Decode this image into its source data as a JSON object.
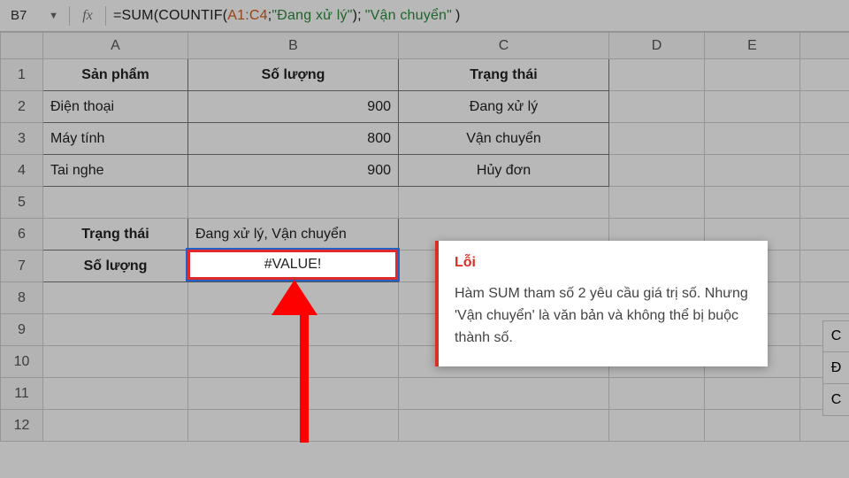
{
  "formula_bar": {
    "cell_ref": "B7",
    "fx_label": "fx",
    "formula_prefix": "=",
    "fn_sum": "SUM",
    "fn_countif": "COUNTIF",
    "range": "A1:C4",
    "sep": ";",
    "str1": "\"Đang xử lý\"",
    "str2": "\"Vận chuyển\""
  },
  "columns": {
    "A": "A",
    "B": "B",
    "C": "C",
    "D": "D",
    "E": "E"
  },
  "rows": [
    "1",
    "2",
    "3",
    "4",
    "5",
    "6",
    "7",
    "8",
    "9",
    "10",
    "11",
    "12"
  ],
  "headers": {
    "product": "Sản phẩm",
    "qty": "Số lượng",
    "status": "Trạng thái"
  },
  "data": [
    {
      "product": "Điện thoại",
      "qty": "900",
      "status": "Đang xử lý"
    },
    {
      "product": "Máy tính",
      "qty": "800",
      "status": "Vận chuyển"
    },
    {
      "product": "Tai nghe",
      "qty": "900",
      "status": "Hủy đơn"
    }
  ],
  "row6": {
    "label": "Trạng thái",
    "value": "Đang xử lý, Vận chuyển"
  },
  "row7": {
    "label": "Số lượng",
    "value": "#VALUE!"
  },
  "error": {
    "title": "Lỗi",
    "message": "Hàm SUM tham số 2 yêu cầu giá trị số. Nhưng 'Vận chuyển' là văn bản và không thể bị buộc thành số."
  },
  "side": [
    "C",
    "Đ",
    "C"
  ]
}
